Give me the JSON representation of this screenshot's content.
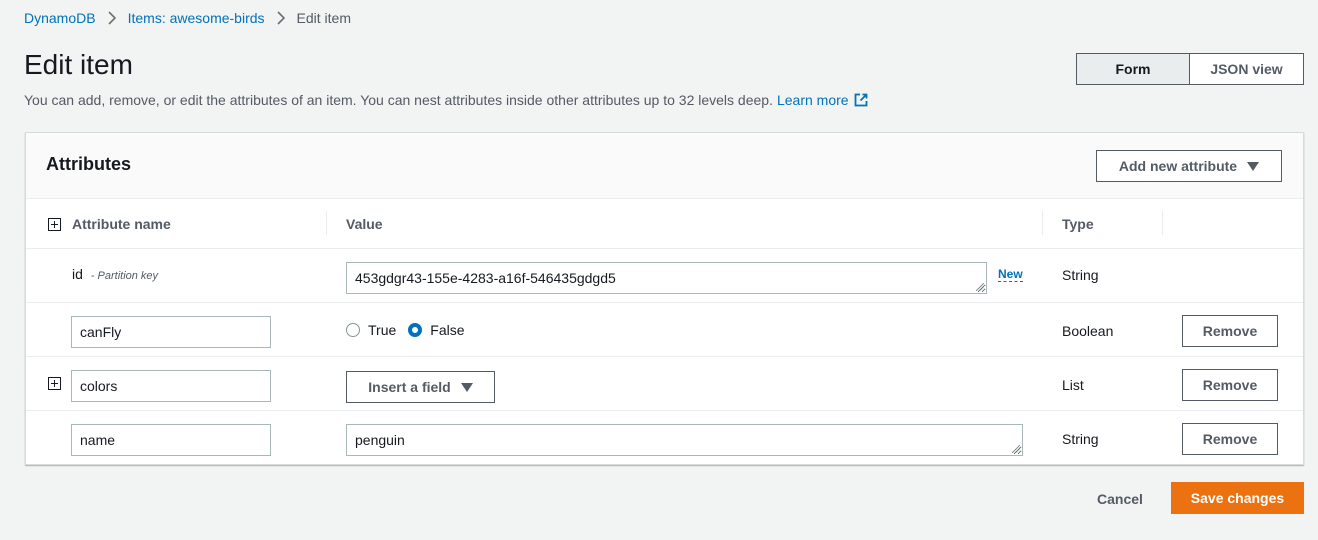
{
  "breadcrumb": {
    "items": [
      "DynamoDB",
      "Items: awesome-birds"
    ],
    "current": "Edit item"
  },
  "header": {
    "title": "Edit item",
    "description": "You can add, remove, or edit the attributes of an item. You can nest attributes inside other attributes up to 32 levels deep.",
    "learn_more": "Learn more"
  },
  "view_toggle": {
    "form": "Form",
    "json": "JSON view",
    "selected": "Form"
  },
  "attributes": {
    "title": "Attributes",
    "add_button": "Add new attribute",
    "columns": {
      "name": "Attribute name",
      "value": "Value",
      "type": "Type"
    },
    "rows": [
      {
        "name": "id",
        "key_note": "- Partition key",
        "value": "453gdgr43-155e-4283-a16f-546435gdgd5",
        "badge": "New",
        "type": "String"
      },
      {
        "name": "canFly",
        "options": [
          "True",
          "False"
        ],
        "selected": "False",
        "type": "Boolean",
        "remove": "Remove"
      },
      {
        "name": "colors",
        "insert": "Insert a field",
        "type": "List",
        "remove": "Remove"
      },
      {
        "name": "name",
        "value": "penguin",
        "type": "String",
        "remove": "Remove"
      }
    ]
  },
  "footer": {
    "cancel": "Cancel",
    "save": "Save changes"
  },
  "colors": {
    "primary": "#ec7211",
    "link": "#0073bb",
    "text": "#16191f",
    "muted": "#545b64"
  }
}
